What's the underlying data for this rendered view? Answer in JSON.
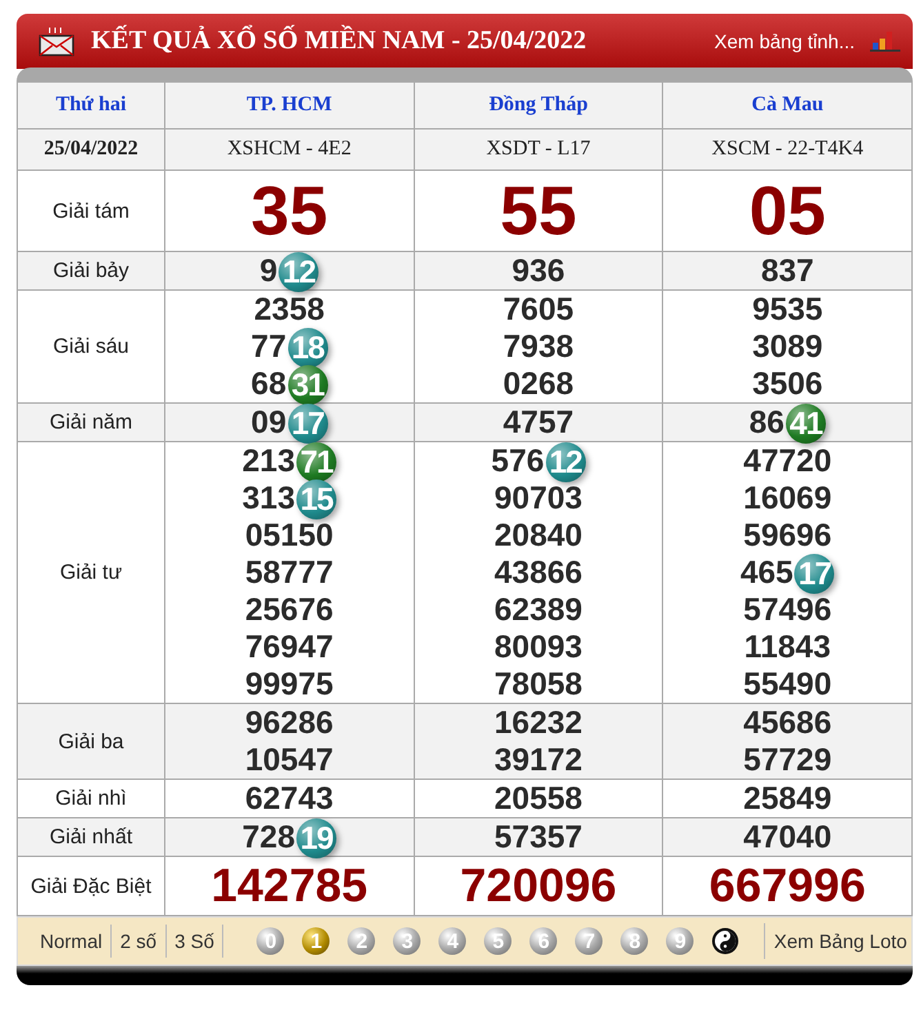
{
  "header": {
    "title": "KẾT QUẢ XỔ SỐ MIỀN NAM - 25/04/2022",
    "link": "Xem bảng tỉnh..."
  },
  "columns": [
    {
      "label": "Thứ hai",
      "kind": "day"
    },
    {
      "label": "TP. HCM",
      "kind": "province"
    },
    {
      "label": "Đồng Tháp",
      "kind": "province"
    },
    {
      "label": "Cà Mau",
      "kind": "province"
    }
  ],
  "codes": [
    {
      "label": "25/04/2022",
      "kind": "date"
    },
    {
      "label": "XSHCM - 4E2",
      "kind": "code"
    },
    {
      "label": "XSDT - L17",
      "kind": "code"
    },
    {
      "label": "XSCM - 22-T4K4",
      "kind": "code"
    }
  ],
  "rows": [
    {
      "label": "Giải tám",
      "kind": "large",
      "cells": [
        [
          {
            "main": "35"
          }
        ],
        [
          {
            "main": "55"
          }
        ],
        [
          {
            "main": "05"
          }
        ]
      ]
    },
    {
      "label": "Giải bảy",
      "kind": "normal",
      "cells": [
        [
          {
            "main": "9",
            "ball": "12",
            "color": "#1f8a8c"
          }
        ],
        [
          {
            "main": "936"
          }
        ],
        [
          {
            "main": "837"
          }
        ]
      ]
    },
    {
      "label": "Giải sáu",
      "kind": "normal",
      "cells": [
        [
          {
            "main": "2358"
          },
          {
            "main": "77",
            "ball": "18",
            "color": "#1f8a8c"
          },
          {
            "main": "68",
            "ball": "31",
            "color": "#1e7a22"
          }
        ],
        [
          {
            "main": "7605"
          },
          {
            "main": "7938"
          },
          {
            "main": "0268"
          }
        ],
        [
          {
            "main": "9535"
          },
          {
            "main": "3089"
          },
          {
            "main": "3506"
          }
        ]
      ]
    },
    {
      "label": "Giải năm",
      "kind": "normal",
      "cells": [
        [
          {
            "main": "09",
            "ball": "17",
            "color": "#1f8a8c"
          }
        ],
        [
          {
            "main": "4757"
          }
        ],
        [
          {
            "main": "86",
            "ball": "41",
            "color": "#1e7a22"
          }
        ]
      ]
    },
    {
      "label": "Giải tư",
      "kind": "normal",
      "cells": [
        [
          {
            "main": "213",
            "ball": "71",
            "color": "#1e7a22"
          },
          {
            "main": "313",
            "ball": "15",
            "color": "#1f8a8c"
          },
          {
            "main": "05150"
          },
          {
            "main": "58777"
          },
          {
            "main": "25676"
          },
          {
            "main": "76947"
          },
          {
            "main": "99975"
          }
        ],
        [
          {
            "main": "576",
            "ball": "12",
            "color": "#1f8a8c"
          },
          {
            "main": "90703"
          },
          {
            "main": "20840"
          },
          {
            "main": "43866"
          },
          {
            "main": "62389"
          },
          {
            "main": "80093"
          },
          {
            "main": "78058"
          }
        ],
        [
          {
            "main": "47720"
          },
          {
            "main": "16069"
          },
          {
            "main": "59696"
          },
          {
            "main": "465",
            "ball": "17",
            "color": "#1f8a8c"
          },
          {
            "main": "57496"
          },
          {
            "main": "11843"
          },
          {
            "main": "55490"
          }
        ]
      ]
    },
    {
      "label": "Giải ba",
      "kind": "normal",
      "cells": [
        [
          {
            "main": "96286"
          },
          {
            "main": "10547"
          }
        ],
        [
          {
            "main": "16232"
          },
          {
            "main": "39172"
          }
        ],
        [
          {
            "main": "45686"
          },
          {
            "main": "57729"
          }
        ]
      ]
    },
    {
      "label": "Giải nhì",
      "kind": "normal",
      "cells": [
        [
          {
            "main": "62743"
          }
        ],
        [
          {
            "main": "20558"
          }
        ],
        [
          {
            "main": "25849"
          }
        ]
      ]
    },
    {
      "label": "Giải nhất",
      "kind": "normal",
      "cells": [
        [
          {
            "main": "728",
            "ball": "19",
            "color": "#1f8a8c"
          }
        ],
        [
          {
            "main": "57357"
          }
        ],
        [
          {
            "main": "47040"
          }
        ]
      ]
    },
    {
      "label": "Giải Đặc Biệt",
      "kind": "special",
      "cells": [
        [
          {
            "main": "142785"
          }
        ],
        [
          {
            "main": "720096"
          }
        ],
        [
          {
            "main": "667996"
          }
        ]
      ]
    }
  ],
  "footer": {
    "modes": [
      {
        "label": "Normal",
        "selected": false
      },
      {
        "label": "2 số",
        "selected": false
      },
      {
        "label": "3 Số",
        "selected": false
      }
    ],
    "digits": [
      {
        "label": "0",
        "selected": false
      },
      {
        "label": "1",
        "selected": true
      },
      {
        "label": "2",
        "selected": false
      },
      {
        "label": "3",
        "selected": false
      },
      {
        "label": "4",
        "selected": false
      },
      {
        "label": "5",
        "selected": false
      },
      {
        "label": "6",
        "selected": false
      },
      {
        "label": "7",
        "selected": false
      },
      {
        "label": "8",
        "selected": false
      },
      {
        "label": "9",
        "selected": false
      }
    ],
    "link": "Xem Bảng Loto"
  }
}
